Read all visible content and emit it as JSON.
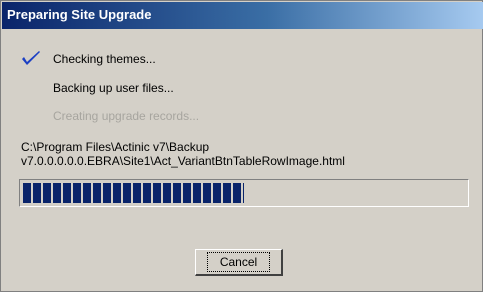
{
  "window": {
    "title": "Preparing Site Upgrade"
  },
  "steps": [
    {
      "label": "Checking themes...",
      "state": "done",
      "icon": "check-icon"
    },
    {
      "label": "Backing up user files...",
      "state": "active"
    },
    {
      "label": "Creating upgrade records...",
      "state": "pending"
    }
  ],
  "current_file": {
    "line1": "C:\\Program Files\\Actinic v7\\Backup",
    "line2": "v7.0.0.0.0.0.EBRA\\Site1\\Act_VariantBtnTableRowImage.html"
  },
  "progress": {
    "fraction": 0.5
  },
  "buttons": {
    "cancel": "Cancel"
  },
  "colors": {
    "title_start": "#0a246a",
    "title_end": "#a6caf0",
    "progress_fill": "#0a246a",
    "check": "#1b3fc4",
    "disabled_text": "#a7a59f"
  }
}
